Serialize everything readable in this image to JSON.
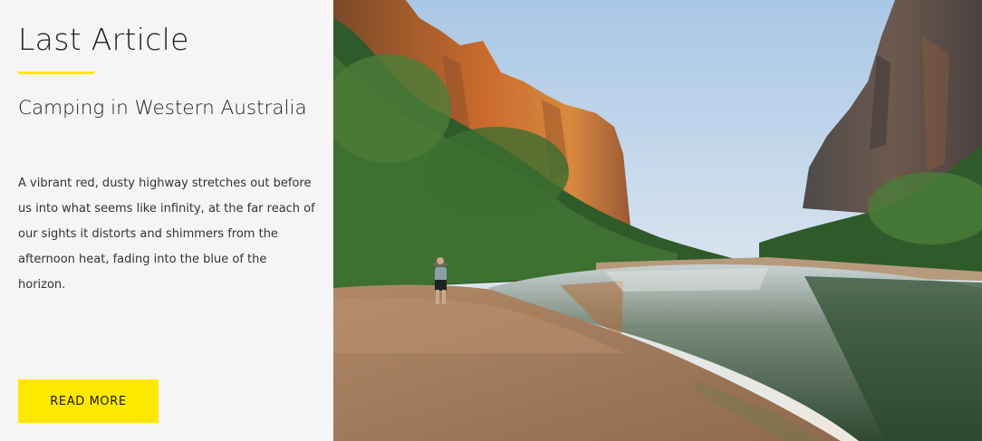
{
  "section": {
    "heading": "Last Article"
  },
  "article": {
    "title": "Camping in Western Australia",
    "excerpt": "A vibrant red, dusty highway stretches out before us into what seems like infinity, at the far reach of our sights it distorts and shimmers from the afternoon heat, fading into the blue of the horizon.",
    "cta_label": "READ MORE",
    "image_subject": "Gorge with red cliffs, river and a person standing on a sandy bank"
  },
  "colors": {
    "accent": "#ffe800",
    "panel_bg": "#f5f5f5",
    "text": "#222222"
  }
}
